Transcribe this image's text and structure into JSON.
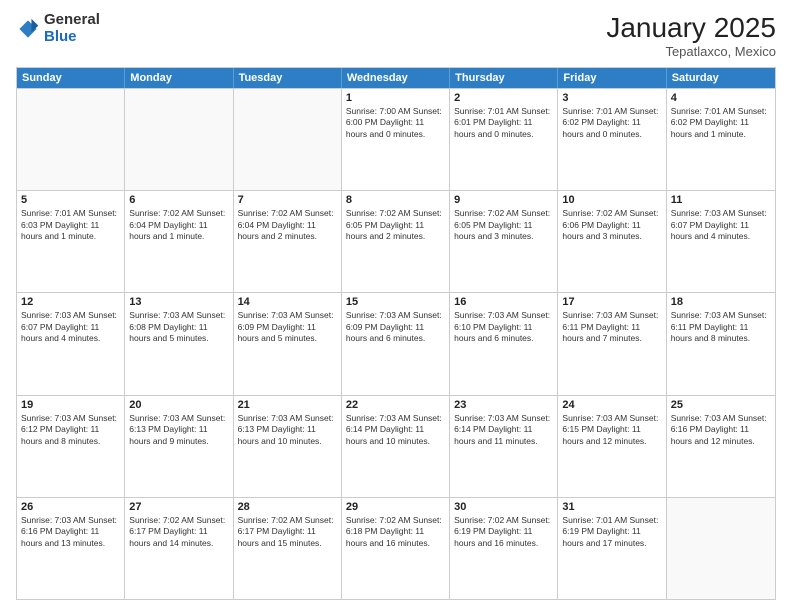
{
  "header": {
    "logo_general": "General",
    "logo_blue": "Blue",
    "month_title": "January 2025",
    "location": "Tepatlaxco, Mexico"
  },
  "weekdays": [
    "Sunday",
    "Monday",
    "Tuesday",
    "Wednesday",
    "Thursday",
    "Friday",
    "Saturday"
  ],
  "weeks": [
    [
      {
        "day": "",
        "info": ""
      },
      {
        "day": "",
        "info": ""
      },
      {
        "day": "",
        "info": ""
      },
      {
        "day": "1",
        "info": "Sunrise: 7:00 AM\nSunset: 6:00 PM\nDaylight: 11 hours\nand 0 minutes."
      },
      {
        "day": "2",
        "info": "Sunrise: 7:01 AM\nSunset: 6:01 PM\nDaylight: 11 hours\nand 0 minutes."
      },
      {
        "day": "3",
        "info": "Sunrise: 7:01 AM\nSunset: 6:02 PM\nDaylight: 11 hours\nand 0 minutes."
      },
      {
        "day": "4",
        "info": "Sunrise: 7:01 AM\nSunset: 6:02 PM\nDaylight: 11 hours\nand 1 minute."
      }
    ],
    [
      {
        "day": "5",
        "info": "Sunrise: 7:01 AM\nSunset: 6:03 PM\nDaylight: 11 hours\nand 1 minute."
      },
      {
        "day": "6",
        "info": "Sunrise: 7:02 AM\nSunset: 6:04 PM\nDaylight: 11 hours\nand 1 minute."
      },
      {
        "day": "7",
        "info": "Sunrise: 7:02 AM\nSunset: 6:04 PM\nDaylight: 11 hours\nand 2 minutes."
      },
      {
        "day": "8",
        "info": "Sunrise: 7:02 AM\nSunset: 6:05 PM\nDaylight: 11 hours\nand 2 minutes."
      },
      {
        "day": "9",
        "info": "Sunrise: 7:02 AM\nSunset: 6:05 PM\nDaylight: 11 hours\nand 3 minutes."
      },
      {
        "day": "10",
        "info": "Sunrise: 7:02 AM\nSunset: 6:06 PM\nDaylight: 11 hours\nand 3 minutes."
      },
      {
        "day": "11",
        "info": "Sunrise: 7:03 AM\nSunset: 6:07 PM\nDaylight: 11 hours\nand 4 minutes."
      }
    ],
    [
      {
        "day": "12",
        "info": "Sunrise: 7:03 AM\nSunset: 6:07 PM\nDaylight: 11 hours\nand 4 minutes."
      },
      {
        "day": "13",
        "info": "Sunrise: 7:03 AM\nSunset: 6:08 PM\nDaylight: 11 hours\nand 5 minutes."
      },
      {
        "day": "14",
        "info": "Sunrise: 7:03 AM\nSunset: 6:09 PM\nDaylight: 11 hours\nand 5 minutes."
      },
      {
        "day": "15",
        "info": "Sunrise: 7:03 AM\nSunset: 6:09 PM\nDaylight: 11 hours\nand 6 minutes."
      },
      {
        "day": "16",
        "info": "Sunrise: 7:03 AM\nSunset: 6:10 PM\nDaylight: 11 hours\nand 6 minutes."
      },
      {
        "day": "17",
        "info": "Sunrise: 7:03 AM\nSunset: 6:11 PM\nDaylight: 11 hours\nand 7 minutes."
      },
      {
        "day": "18",
        "info": "Sunrise: 7:03 AM\nSunset: 6:11 PM\nDaylight: 11 hours\nand 8 minutes."
      }
    ],
    [
      {
        "day": "19",
        "info": "Sunrise: 7:03 AM\nSunset: 6:12 PM\nDaylight: 11 hours\nand 8 minutes."
      },
      {
        "day": "20",
        "info": "Sunrise: 7:03 AM\nSunset: 6:13 PM\nDaylight: 11 hours\nand 9 minutes."
      },
      {
        "day": "21",
        "info": "Sunrise: 7:03 AM\nSunset: 6:13 PM\nDaylight: 11 hours\nand 10 minutes."
      },
      {
        "day": "22",
        "info": "Sunrise: 7:03 AM\nSunset: 6:14 PM\nDaylight: 11 hours\nand 10 minutes."
      },
      {
        "day": "23",
        "info": "Sunrise: 7:03 AM\nSunset: 6:14 PM\nDaylight: 11 hours\nand 11 minutes."
      },
      {
        "day": "24",
        "info": "Sunrise: 7:03 AM\nSunset: 6:15 PM\nDaylight: 11 hours\nand 12 minutes."
      },
      {
        "day": "25",
        "info": "Sunrise: 7:03 AM\nSunset: 6:16 PM\nDaylight: 11 hours\nand 12 minutes."
      }
    ],
    [
      {
        "day": "26",
        "info": "Sunrise: 7:03 AM\nSunset: 6:16 PM\nDaylight: 11 hours\nand 13 minutes."
      },
      {
        "day": "27",
        "info": "Sunrise: 7:02 AM\nSunset: 6:17 PM\nDaylight: 11 hours\nand 14 minutes."
      },
      {
        "day": "28",
        "info": "Sunrise: 7:02 AM\nSunset: 6:17 PM\nDaylight: 11 hours\nand 15 minutes."
      },
      {
        "day": "29",
        "info": "Sunrise: 7:02 AM\nSunset: 6:18 PM\nDaylight: 11 hours\nand 16 minutes."
      },
      {
        "day": "30",
        "info": "Sunrise: 7:02 AM\nSunset: 6:19 PM\nDaylight: 11 hours\nand 16 minutes."
      },
      {
        "day": "31",
        "info": "Sunrise: 7:01 AM\nSunset: 6:19 PM\nDaylight: 11 hours\nand 17 minutes."
      },
      {
        "day": "",
        "info": ""
      }
    ]
  ]
}
